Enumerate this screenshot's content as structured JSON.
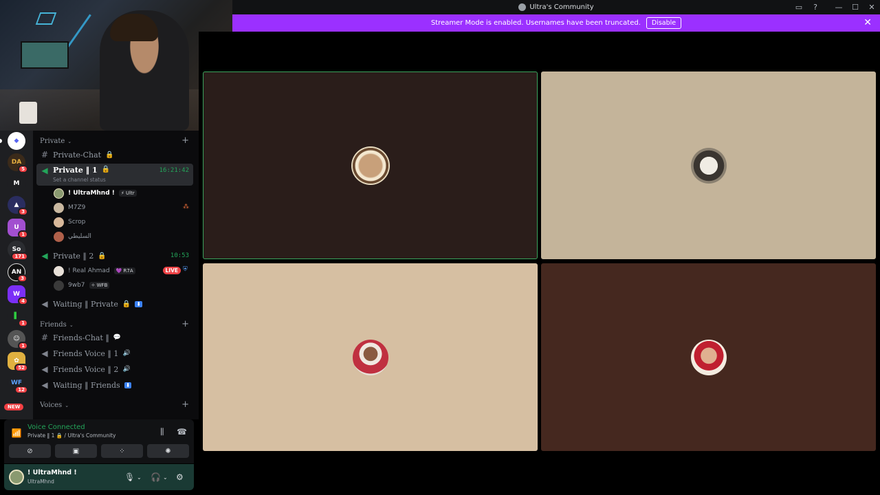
{
  "window": {
    "title": "Ultra's Community"
  },
  "banner": {
    "text": "Streamer Mode is enabled. Usernames have been truncated.",
    "button": "Disable"
  },
  "guilds": [
    {
      "badge": ""
    },
    {
      "badge": "5"
    },
    {
      "badge": ""
    },
    {
      "badge": "3"
    },
    {
      "badge": "1"
    },
    {
      "badge": "171"
    },
    {
      "badge": "3"
    },
    {
      "badge": "4"
    },
    {
      "badge": "1"
    },
    {
      "badge": "1"
    },
    {
      "badge": "52"
    },
    {
      "badge": "12"
    }
  ],
  "guild_new": "NEW",
  "channels": {
    "cat_private": "Private",
    "private_chat": "Private-Chat",
    "private1": {
      "name": "Private ‖ 1",
      "time": "16:21:42",
      "status": "Set a channel status"
    },
    "private1_users": [
      {
        "name": "! UltraMhnd !",
        "tag": "⚡ Ultr"
      },
      {
        "name": "M7Z9",
        "tag": ""
      },
      {
        "name": "Scrop",
        "tag": ""
      },
      {
        "name": "السليطي",
        "tag": ""
      }
    ],
    "private2": {
      "name": "Private ‖ 2",
      "time": "10:53"
    },
    "private2_users": [
      {
        "name": "! Real Ahmad",
        "tag": "💜 R7A",
        "live": "LIVE"
      },
      {
        "name": "9wb7",
        "tag": "✧ WFB"
      }
    ],
    "waiting_private": "Waiting ‖ Private",
    "cat_friends": "Friends",
    "friends_chat": "Friends-Chat ‖",
    "friends_voice1": "Friends Voice ‖ 1",
    "friends_voice2": "Friends Voice ‖ 2",
    "waiting_friends": "Waiting ‖ Friends",
    "cat_voices": "Voices"
  },
  "voice": {
    "status": "Voice Connected",
    "channel": "Private ‖ 1 🔒 / Ultra's Community"
  },
  "user": {
    "name": "! UltraMhnd !",
    "sub": "UltraMhnd"
  },
  "icons": {
    "titlebar": [
      "screen-share-icon",
      "help-icon",
      "minimize-icon",
      "maximize-icon",
      "close-icon"
    ],
    "vc_buttons": [
      "video-off-icon",
      "screen-share-icon",
      "activities-icon",
      "soundboard-icon"
    ]
  },
  "colors": {
    "accent": "#9b30ff",
    "voice_green": "#23a55a",
    "live_red": "#ed4245",
    "tile1": "#2a1d1a",
    "tile2": "#c4b49a",
    "tile3": "#d6bfa2",
    "tile4": "#45281f"
  }
}
